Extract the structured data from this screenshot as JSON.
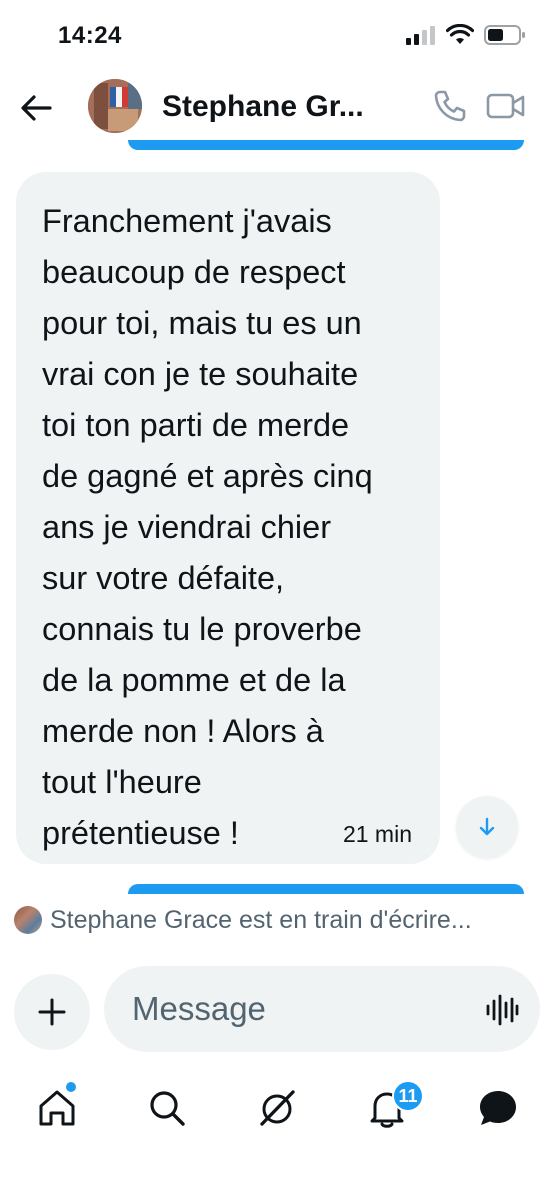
{
  "status_bar": {
    "time": "14:24"
  },
  "header": {
    "contact_name": "Stephane Gr...",
    "icons": [
      "back-arrow-icon",
      "phone-icon",
      "video-camera-icon"
    ]
  },
  "conversation": {
    "message": {
      "text": "Franchement j'avais\nbeaucoup de respect\npour toi, mais tu es un\nvrai con je te souhaite\ntoi ton parti de merde\nde gagné et après cinq\nans je viendrai chier\nsur votre défaite,\nconnais tu le proverbe\nde la pomme et de la\nmerde non ! Alors à\ntout l'heure\nprétentieuse  !",
      "time": "21 min"
    },
    "typing_indicator": "Stephane Grace est en train d'écrire..."
  },
  "composer": {
    "placeholder": "Message"
  },
  "nav": {
    "items": [
      "home-icon",
      "search-icon",
      "grok-icon",
      "notifications-icon",
      "messages-icon"
    ],
    "notifications_badge": "11"
  },
  "colors": {
    "accent": "#1d9bf0",
    "bubble_bg": "#eff3f4",
    "secondary_text": "#536471"
  }
}
